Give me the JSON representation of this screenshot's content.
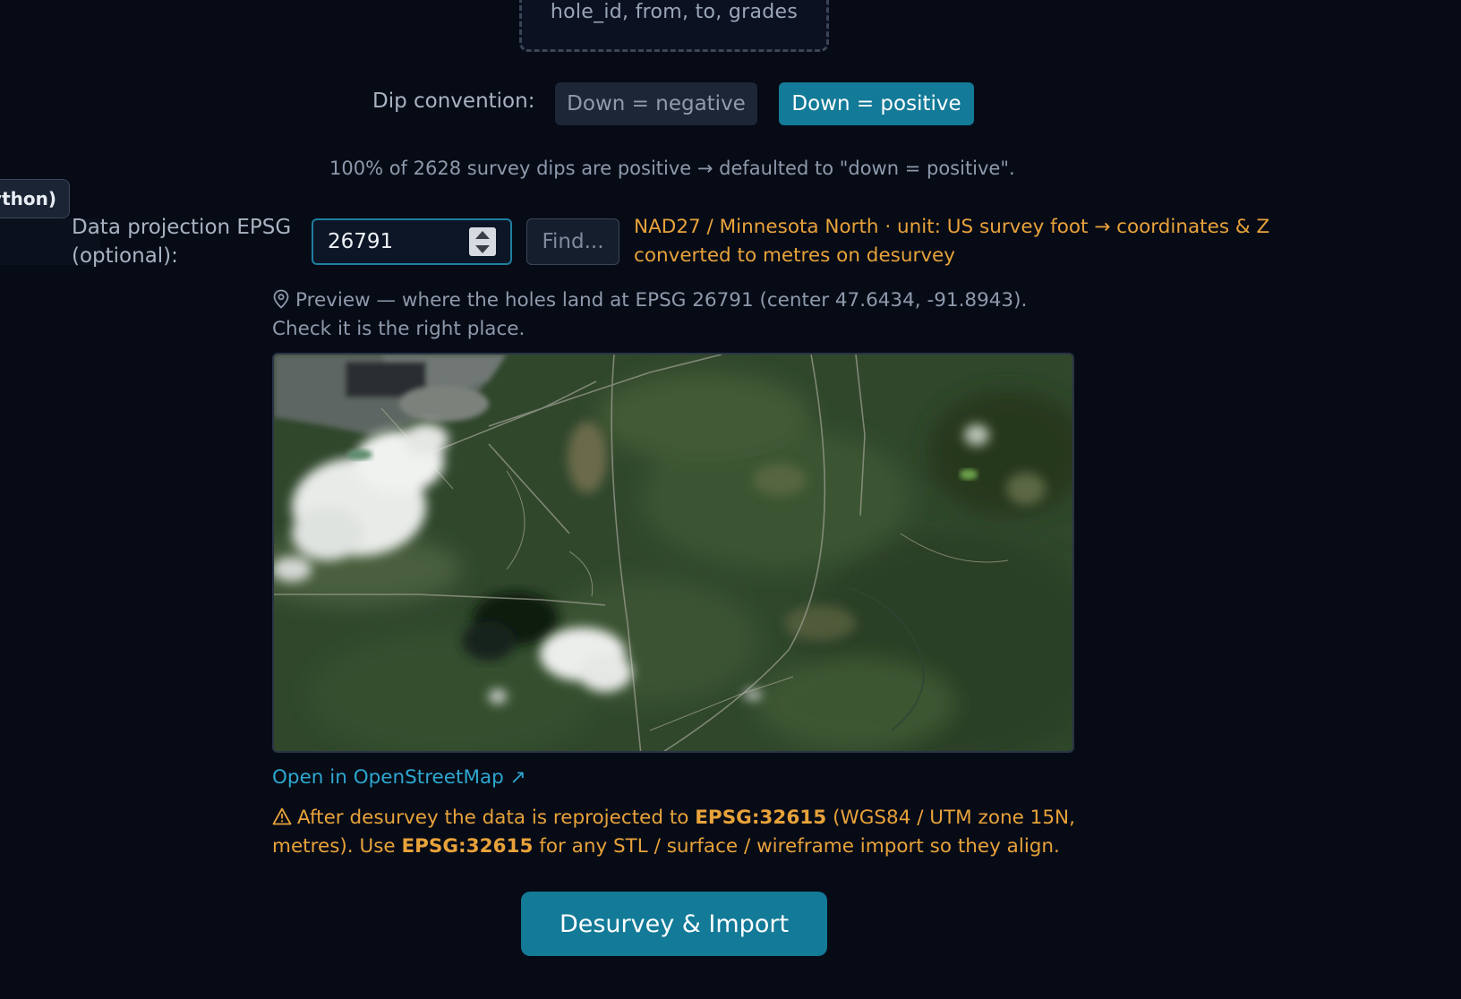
{
  "dropzone": {
    "hint": "hole_id, from, to, grades"
  },
  "dip": {
    "label": "Dip convention:",
    "options": [
      "Down = negative",
      "Down = positive"
    ],
    "selected": "Down = positive",
    "note": "100% of 2628 survey dips are positive → defaulted to \"down = positive\"."
  },
  "side_pill": {
    "label": "ython)"
  },
  "epsg": {
    "label": "Data projection EPSG (optional):",
    "value": "26791",
    "find_label": "Find...",
    "info": "NAD27 / Minnesota North · unit: US survey foot → coordinates & Z converted to metres on desurvey"
  },
  "preview": {
    "text": "Preview — where the holes land at EPSG 26791 (center 47.6434, -91.8943). Check it is the right place."
  },
  "osm_link": {
    "label": "Open in OpenStreetMap ↗"
  },
  "warning": {
    "part1": "After desurvey the data is reprojected to ",
    "code1": "EPSG:32615",
    "part2": " (WGS84 / UTM zone 15N, metres). Use ",
    "code2": "EPSG:32615",
    "part3": " for any STL / surface / wireframe import so they align."
  },
  "submit": {
    "label": "Desurvey & Import"
  },
  "colors": {
    "accent": "#137a98",
    "warning": "#e8a23a",
    "link": "#2fa6cf",
    "background": "#060b16"
  },
  "icons": [
    "map-pin-icon",
    "warning-triangle-icon",
    "spinner-up-icon",
    "spinner-down-icon"
  ]
}
